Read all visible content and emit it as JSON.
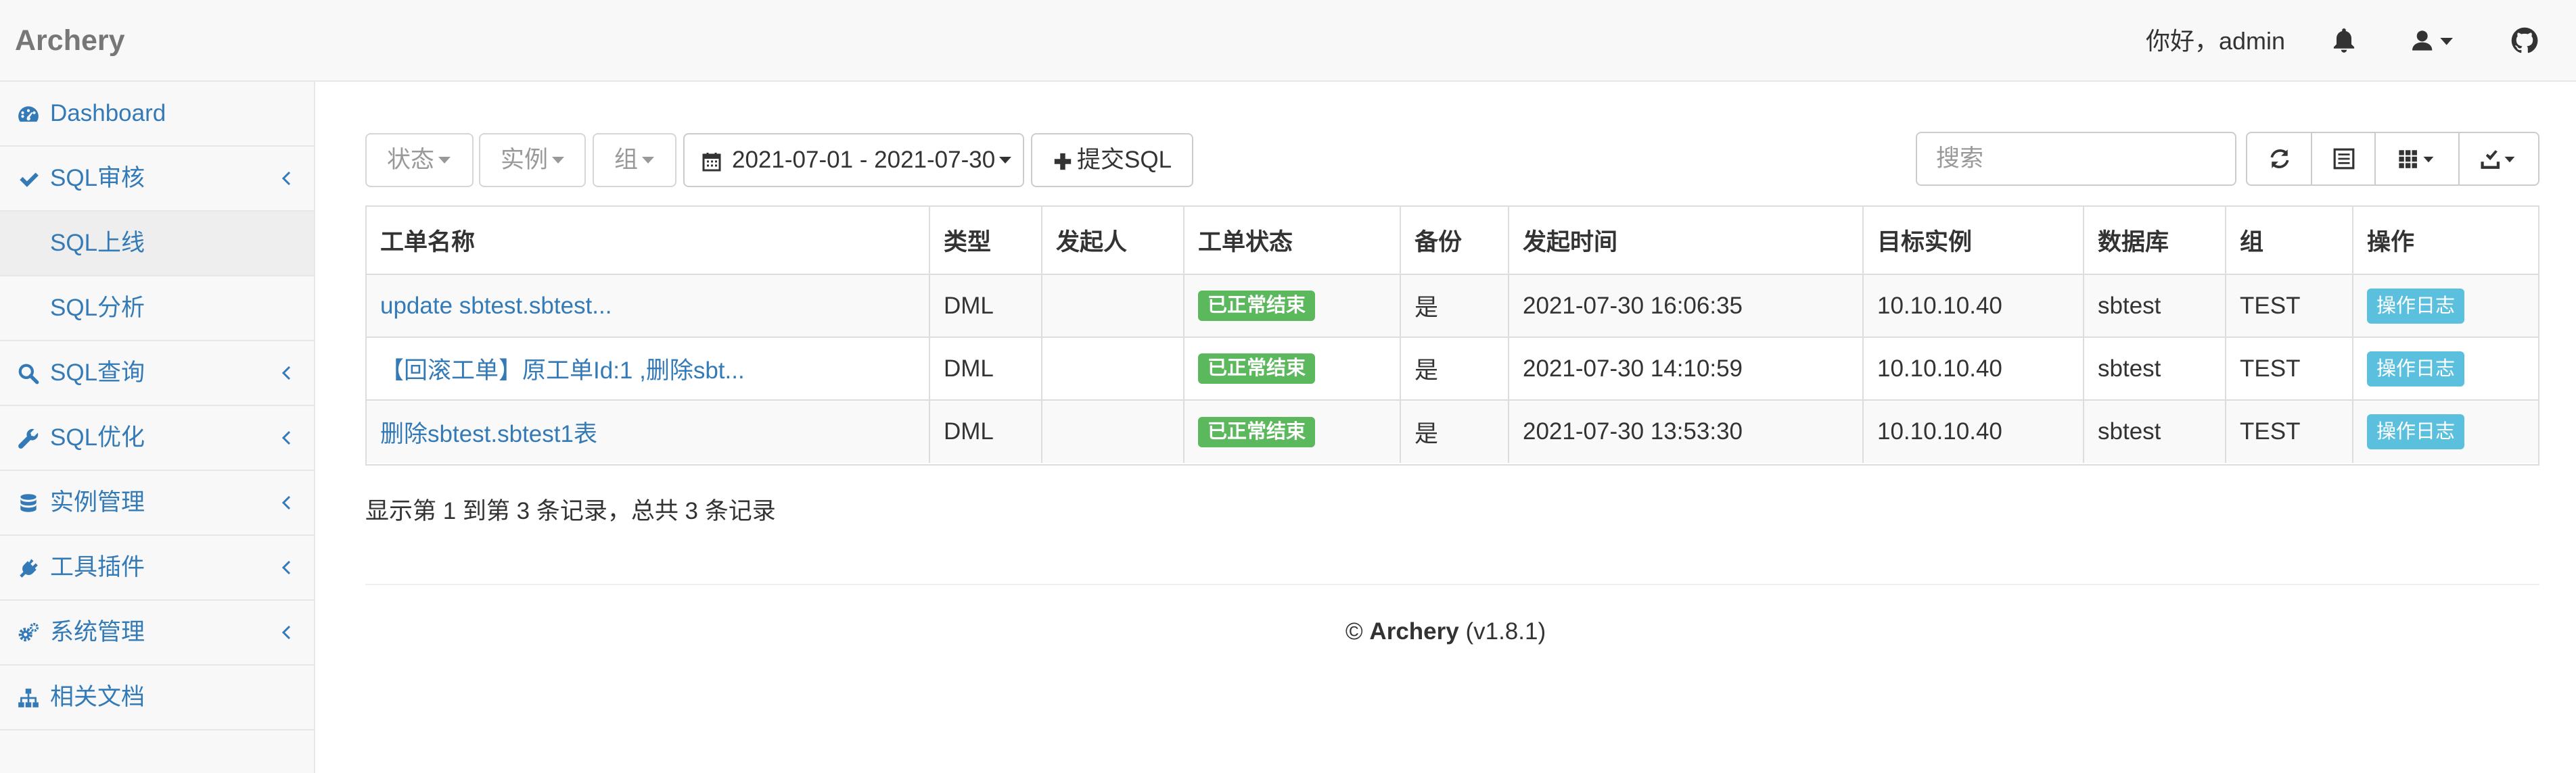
{
  "app": {
    "brand": "Archery",
    "greeting": "你好，admin"
  },
  "navbar": {
    "icons": [
      "bell-icon",
      "user-icon",
      "github-icon"
    ]
  },
  "sidebar": {
    "items": [
      {
        "label": "Dashboard",
        "icon": "dashboard-icon"
      },
      {
        "label": "SQL审核",
        "icon": "check-icon",
        "expanded": true
      },
      {
        "label": "SQL上线",
        "sub": true,
        "active": true
      },
      {
        "label": "SQL分析",
        "sub": true
      },
      {
        "label": "SQL查询",
        "icon": "search-icon"
      },
      {
        "label": "SQL优化",
        "icon": "wrench-icon"
      },
      {
        "label": "实例管理",
        "icon": "database-icon"
      },
      {
        "label": "工具插件",
        "icon": "plug-icon"
      },
      {
        "label": "系统管理",
        "icon": "cogs-icon"
      },
      {
        "label": "相关文档",
        "icon": "sitemap-icon"
      }
    ]
  },
  "toolbar": {
    "status_label": "状态",
    "instance_label": "实例",
    "group_label": "组",
    "date_range": "2021-07-01 - 2021-07-30",
    "submit_label": "提交SQL",
    "search_placeholder": "搜索"
  },
  "table": {
    "headers": [
      "工单名称",
      "类型",
      "发起人",
      "工单状态",
      "备份",
      "发起时间",
      "目标实例",
      "数据库",
      "组",
      "操作"
    ],
    "rows": [
      {
        "name": "update sbtest.sbtest...",
        "type": "DML",
        "initiator": "",
        "status": "已正常结束",
        "backup": "是",
        "time": "2021-07-30 16:06:35",
        "instance": "10.10.10.40",
        "database": "sbtest",
        "group": "TEST",
        "action": "操作日志"
      },
      {
        "name": "【回滚工单】原工单Id:1 ,删除sbt...",
        "type": "DML",
        "initiator": "",
        "status": "已正常结束",
        "backup": "是",
        "time": "2021-07-30 14:10:59",
        "instance": "10.10.10.40",
        "database": "sbtest",
        "group": "TEST",
        "action": "操作日志"
      },
      {
        "name": "删除sbtest.sbtest1表",
        "type": "DML",
        "initiator": "",
        "status": "已正常结束",
        "backup": "是",
        "time": "2021-07-30 13:53:30",
        "instance": "10.10.10.40",
        "database": "sbtest",
        "group": "TEST",
        "action": "操作日志"
      }
    ]
  },
  "pagination": {
    "info": "显示第 1 到第 3 条记录，总共 3 条记录"
  },
  "footer": {
    "copyright": "©",
    "name": "Archery",
    "version": "(v1.8.1)"
  },
  "colors": {
    "link": "#337ab7",
    "success": "#5cb85c",
    "info": "#5bc0de",
    "brand": "#777777"
  }
}
